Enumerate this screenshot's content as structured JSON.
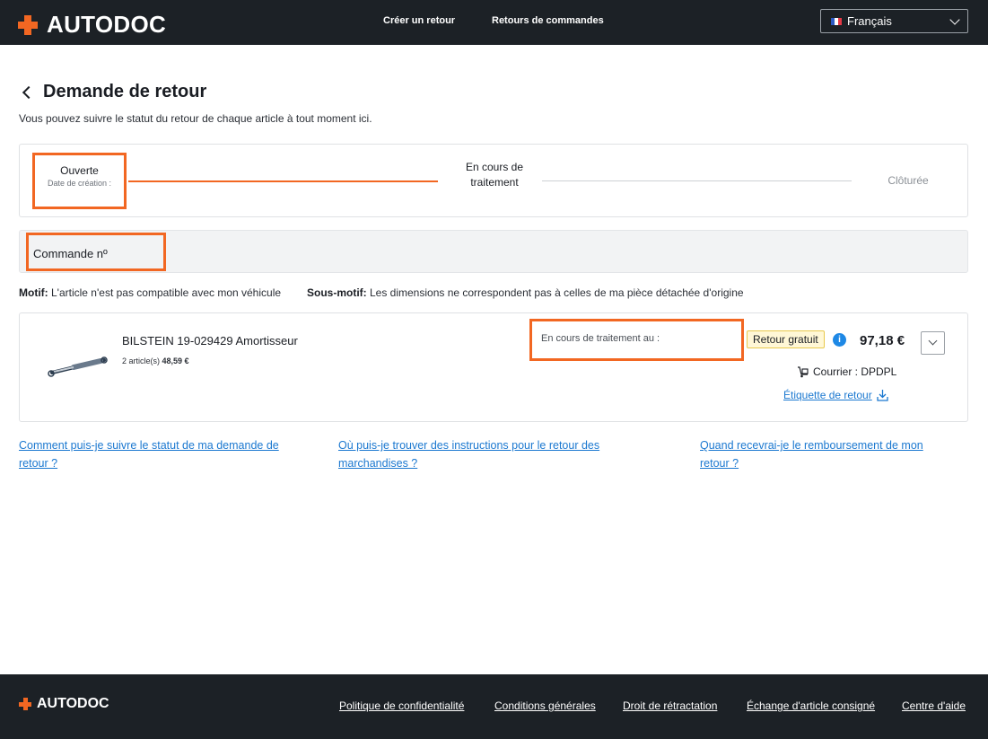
{
  "brand": {
    "name": "AUTODOC",
    "accent": "#f26722"
  },
  "header": {
    "nav": [
      "Créer un retour",
      "Retours de commandes"
    ],
    "language": "Français"
  },
  "page": {
    "title": "Demande de retour",
    "subtitle": "Vous pouvez suivre le statut du retour de chaque article à tout moment ici."
  },
  "stepper": {
    "steps": [
      {
        "label": "Ouverte",
        "sub": "Date de création :"
      },
      {
        "label": "En cours de traitement"
      },
      {
        "label": "Clôturée"
      }
    ],
    "current_step": 1
  },
  "order": {
    "label": "Commande nº"
  },
  "reasons": {
    "motif_label": "Motif:",
    "motif_value": " L'article n'est pas compatible avec mon véhicule",
    "sous_motif_label": "Sous-motif:",
    "sous_motif_value": " Les dimensions ne correspondent pas à celles de ma pièce détachée d'origine"
  },
  "item": {
    "name": "BILSTEIN 19-029429 Amortisseur",
    "qty": "2 article(s)",
    "unit_price": "48,59 €",
    "processing": "En cours de traitement au :",
    "badge": "Retour gratuit",
    "price": "97,18 €",
    "courier": "Courrier : DPDPL",
    "return_label": "Étiquette de retour"
  },
  "faq": [
    {
      "line1": "Comment puis-je suivre le statut de ma demande de",
      "line2": "retour ?"
    },
    {
      "line1": "Où puis-je trouver des instructions pour le retour des",
      "line2": "marchandises ?"
    },
    {
      "line1": "Quand recevrai-je le remboursement de mon",
      "line2": "retour ?"
    }
  ],
  "footer": {
    "brand": "AUTODOC",
    "links": [
      "Politique de confidentialité",
      "Conditions générales",
      "Droit de rétractation",
      "Échange d'article consigné",
      "Centre d'aide"
    ]
  }
}
